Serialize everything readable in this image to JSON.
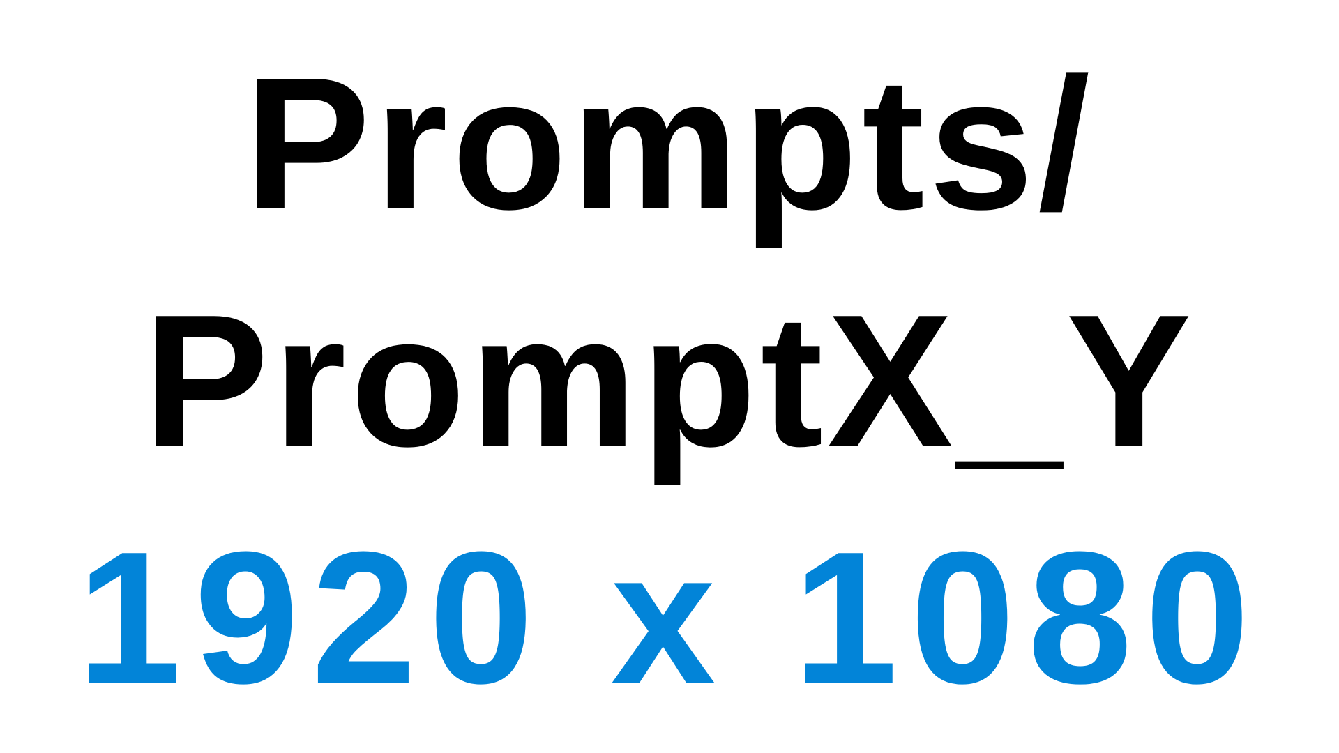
{
  "lines": {
    "line1": "Prompts/",
    "line2": "PromptX_Y",
    "line3": "1920 x 1080"
  },
  "colors": {
    "background": "#ffffff",
    "primary_text": "#000000",
    "accent_text": "#0284d8"
  }
}
